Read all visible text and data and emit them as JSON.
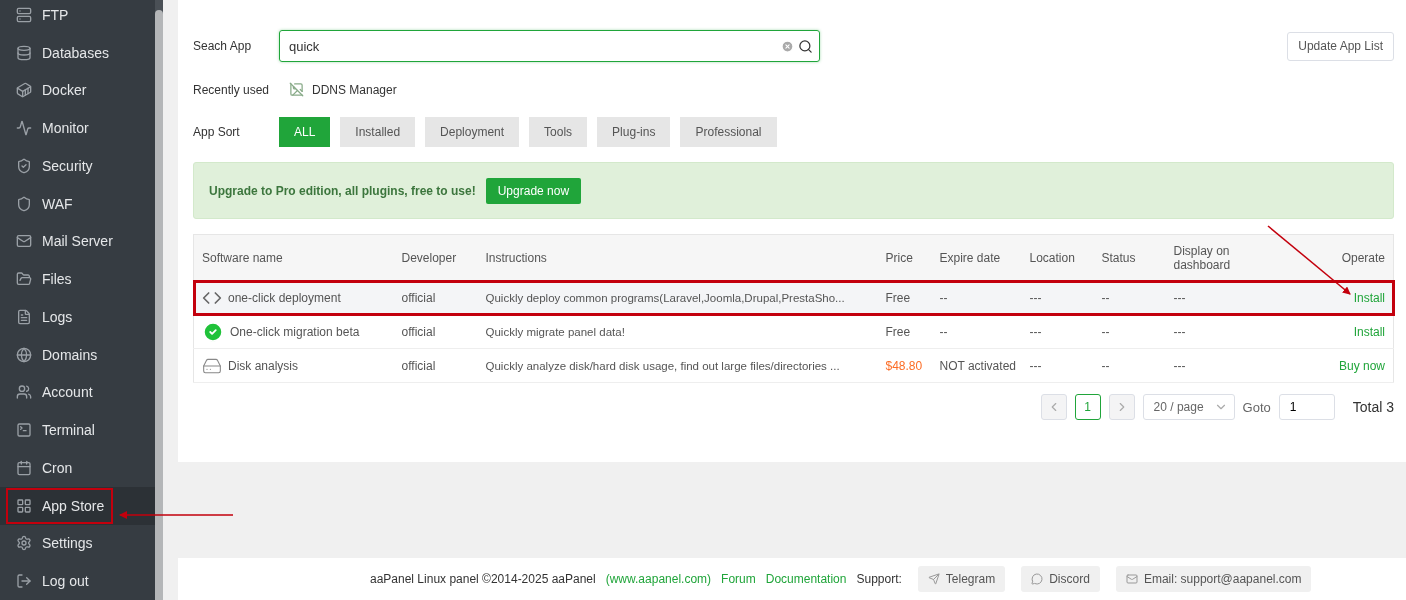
{
  "sidebar": {
    "items": [
      {
        "label": "FTP",
        "kind": "ftp",
        "selected": false,
        "highlighted": false
      },
      {
        "label": "Databases",
        "kind": "database",
        "selected": false,
        "highlighted": false
      },
      {
        "label": "Docker",
        "kind": "docker",
        "selected": false,
        "highlighted": false
      },
      {
        "label": "Monitor",
        "kind": "monitor",
        "selected": false,
        "highlighted": false
      },
      {
        "label": "Security",
        "kind": "security",
        "selected": false,
        "highlighted": false
      },
      {
        "label": "WAF",
        "kind": "waf",
        "selected": false,
        "highlighted": false
      },
      {
        "label": "Mail Server",
        "kind": "mail",
        "selected": false,
        "highlighted": false
      },
      {
        "label": "Files",
        "kind": "files",
        "selected": false,
        "highlighted": false
      },
      {
        "label": "Logs",
        "kind": "logs",
        "selected": false,
        "highlighted": false
      },
      {
        "label": "Domains",
        "kind": "domains",
        "selected": false,
        "highlighted": false
      },
      {
        "label": "Account",
        "kind": "account",
        "selected": false,
        "highlighted": false
      },
      {
        "label": "Terminal",
        "kind": "terminal",
        "selected": false,
        "highlighted": false
      },
      {
        "label": "Cron",
        "kind": "cron",
        "selected": false,
        "highlighted": false
      },
      {
        "label": "App Store",
        "kind": "appstore",
        "selected": true,
        "highlighted": true
      },
      {
        "label": "Settings",
        "kind": "settings",
        "selected": false,
        "highlighted": false
      },
      {
        "label": "Log out",
        "kind": "logout",
        "selected": false,
        "highlighted": false
      }
    ]
  },
  "search": {
    "label": "Seach App",
    "value": "quick"
  },
  "update_button": "Update App List",
  "recently_used": {
    "label": "Recently used",
    "items": [
      "DDNS Manager"
    ]
  },
  "app_sort": {
    "label": "App Sort",
    "options": [
      {
        "label": "ALL",
        "selected": true
      },
      {
        "label": "Installed",
        "selected": false
      },
      {
        "label": "Deployment",
        "selected": false
      },
      {
        "label": "Tools",
        "selected": false
      },
      {
        "label": "Plug-ins",
        "selected": false
      },
      {
        "label": "Professional",
        "selected": false
      }
    ]
  },
  "banner": {
    "text": "Upgrade to Pro edition, all plugins, free to use!",
    "button": "Upgrade now"
  },
  "table": {
    "columns": [
      "Software name",
      "Developer",
      "Instructions",
      "Price",
      "Expire date",
      "Location",
      "Status",
      "Display on dashboard",
      "Operate"
    ],
    "rows": [
      {
        "kind": "code",
        "name": "one-click deployment",
        "developer": "official",
        "instructions": "Quickly deploy common programs(Laravel,Joomla,Drupal,PrestaSho...",
        "price": "Free",
        "paid": false,
        "expire": "--",
        "location": "---",
        "status": "--",
        "display": "---",
        "operate": "Install",
        "highlighted": true
      },
      {
        "kind": "check",
        "name": "One-click migration beta",
        "developer": "official",
        "instructions": "Quickly migrate panel data!",
        "price": "Free",
        "paid": false,
        "expire": "--",
        "location": "---",
        "status": "--",
        "display": "---",
        "operate": "Install",
        "highlighted": false
      },
      {
        "kind": "disk",
        "name": "Disk analysis",
        "developer": "official",
        "instructions": "Quickly analyze disk/hard disk usage, find out large files/directories ...",
        "price": "$48.80",
        "paid": true,
        "expire": "NOT activated",
        "location": "---",
        "status": "--",
        "display": "---",
        "operate": "Buy now",
        "highlighted": false
      }
    ]
  },
  "pagination": {
    "pages": [
      {
        "label": "1",
        "selected": true
      }
    ],
    "page_size": "20 / page",
    "goto_label": "Goto",
    "goto_value": "1",
    "total": "Total 3"
  },
  "footer": {
    "copyright": "aaPanel Linux panel ©2014-2025 aaPanel",
    "links": [
      "(www.aapanel.com)",
      "Forum",
      "Documentation"
    ],
    "support_label": "Support:",
    "support": [
      {
        "label": "Telegram",
        "kind": "telegram"
      },
      {
        "label": "Discord",
        "kind": "discord"
      },
      {
        "label": "Email: support@aapanel.com",
        "kind": "email"
      }
    ]
  }
}
